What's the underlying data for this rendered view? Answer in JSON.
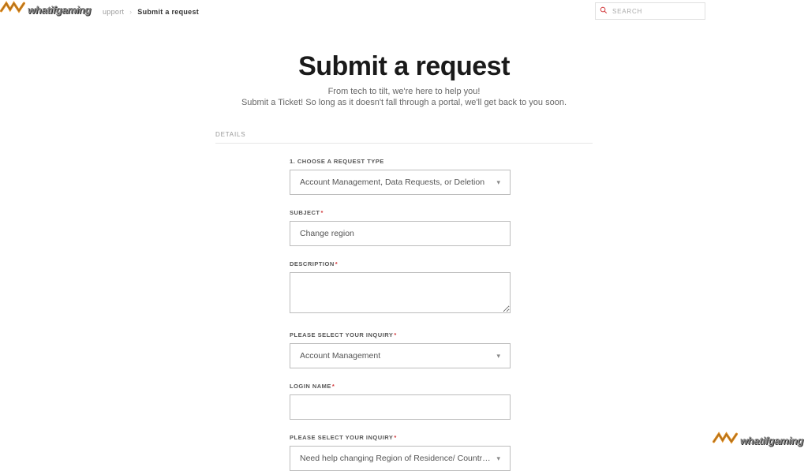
{
  "watermark": {
    "brand": "whatifgaming"
  },
  "breadcrumb": {
    "parent": "upport",
    "current": "Submit a request"
  },
  "search": {
    "placeholder": "SEARCH",
    "value": ""
  },
  "hero": {
    "title": "Submit a request",
    "line1": "From tech to tilt, we're here to help you!",
    "line2": "Submit a Ticket! So long as it doesn't fall through a portal, we'll get back to you soon."
  },
  "section": {
    "label": "DETAILS"
  },
  "form": {
    "request_type": {
      "label": "1. CHOOSE A REQUEST TYPE",
      "value": "Account Management, Data Requests, or Deletion"
    },
    "subject": {
      "label": "SUBJECT",
      "value": "Change region"
    },
    "description": {
      "label": "DESCRIPTION",
      "value": ""
    },
    "inquiry1": {
      "label": "PLEASE SELECT YOUR INQUIRY",
      "value": "Account Management"
    },
    "login_name": {
      "label": "LOGIN NAME",
      "value": ""
    },
    "inquiry2": {
      "label": "PLEASE SELECT YOUR INQUIRY",
      "value": "Need help changing Region of Residence/ Country assi…"
    }
  }
}
